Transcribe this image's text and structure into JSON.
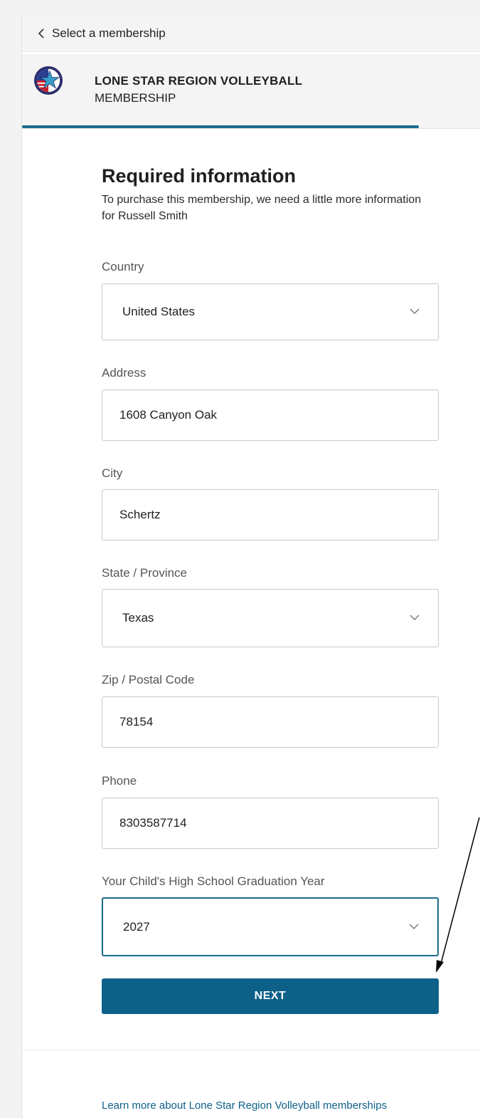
{
  "nav": {
    "back_label": "Select a membership"
  },
  "header": {
    "org_name": "LONE STAR REGION VOLLEYBALL",
    "section": "MEMBERSHIP"
  },
  "form": {
    "title": "Required information",
    "subtitle": "To purchase this membership, we need a little more information for Russell Smith",
    "fields": [
      {
        "label": "Country",
        "value": "United States",
        "type": "select"
      },
      {
        "label": "Address",
        "value": "1608 Canyon Oak",
        "type": "text"
      },
      {
        "label": "City",
        "value": "Schertz",
        "type": "text"
      },
      {
        "label": "State / Province",
        "value": "Texas",
        "type": "select"
      },
      {
        "label": "Zip / Postal Code",
        "value": "78154",
        "type": "text"
      },
      {
        "label": "Phone",
        "value": "8303587714",
        "type": "text"
      },
      {
        "label": "Your Child's High School Graduation Year",
        "value": "2027",
        "type": "select"
      }
    ],
    "next_label": "NEXT"
  },
  "footer": {
    "learn_more": "Learn more about Lone Star Region Volleyball memberships"
  },
  "colors": {
    "accent": "#0d6088",
    "progress": "#1b6a8b"
  },
  "icons": {
    "back": "chevron-left-icon",
    "dropdown": "chevron-down-icon",
    "logo": "star-seal-logo"
  }
}
